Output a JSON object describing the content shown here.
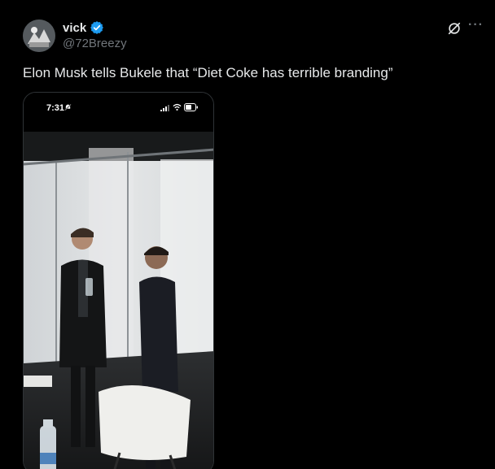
{
  "author": {
    "display_name": "vick",
    "handle": "@72Breezy",
    "verified": true
  },
  "tweet": {
    "text": "Elon Musk tells Bukele that “Diet Coke has terrible branding”"
  },
  "media": {
    "status_time": "7:31"
  },
  "icons": {
    "verified": "verified-badge-icon",
    "grok": "grok-icon",
    "more": "more-options-icon"
  },
  "colors": {
    "background": "#000000",
    "text_primary": "#e7e9ea",
    "text_secondary": "#71767b",
    "verified_blue": "#1d9bf0"
  }
}
